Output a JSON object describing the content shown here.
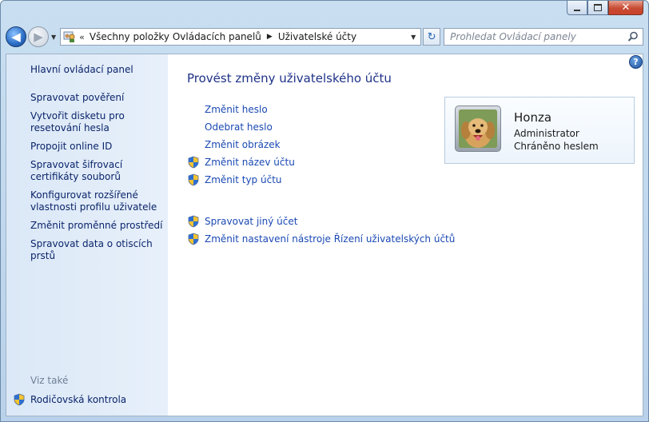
{
  "window": {
    "minimize": "minimize",
    "maximize": "maximize",
    "close": "✕"
  },
  "navbar": {
    "back": "◀",
    "forward": "▶",
    "recent": "▼",
    "address_chevron": "«",
    "breadcrumbs": [
      "Všechny položky Ovládacích panelů",
      "Uživatelské účty"
    ],
    "separator": "▶",
    "dropdown": "▼",
    "refresh": "↻",
    "search_placeholder": "Prohledat Ovládací panely"
  },
  "sidebar": {
    "home": "Hlavní ovládací panel",
    "items": [
      "Spravovat pověření",
      "Vytvořit disketu pro resetování hesla",
      "Propojit online ID",
      "Spravovat šifrovací certifikáty souborů",
      "Konfigurovat rozšířené vlastnosti profilu uživatele",
      "Změnit proměnné prostředí",
      "Spravovat data o otiscích prstů"
    ],
    "see_also": "Viz také",
    "parental": "Rodičovská kontrola"
  },
  "main": {
    "help": "?",
    "heading": "Provést změny uživatelského účtu",
    "tasks": [
      {
        "label": "Změnit heslo",
        "shield": false
      },
      {
        "label": "Odebrat heslo",
        "shield": false
      },
      {
        "label": "Změnit obrázek",
        "shield": false
      },
      {
        "label": "Změnit název účtu",
        "shield": true
      },
      {
        "label": "Změnit typ účtu",
        "shield": true
      }
    ],
    "tasks2": [
      {
        "label": "Spravovat jiný účet",
        "shield": true
      },
      {
        "label": "Změnit nastavení nástroje Řízení uživatelských účtů",
        "shield": true
      }
    ]
  },
  "account": {
    "name": "Honza",
    "role": "Administrator",
    "status": "Chráněno heslem"
  },
  "colors": {
    "link": "#1a49b3",
    "heading": "#1e3287",
    "sidebar_link": "#0a246a"
  }
}
